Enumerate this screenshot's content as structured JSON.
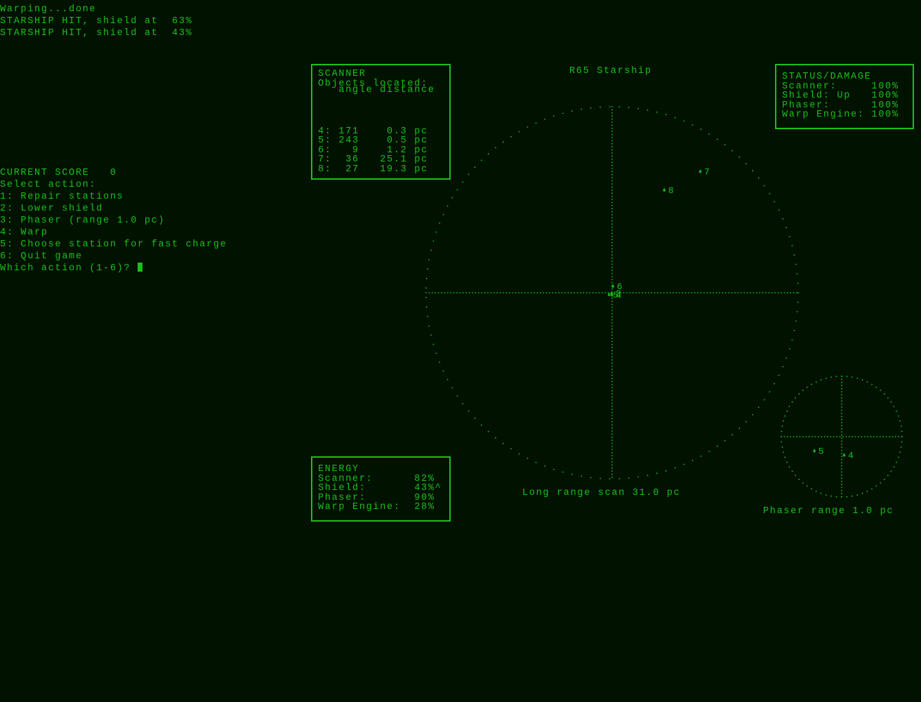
{
  "log": [
    "Warping...done",
    "STARSHIP HIT, shield at  63%",
    "STARSHIP HIT, shield at  43%"
  ],
  "menu": {
    "score_label": "CURRENT SCORE   0",
    "prompt_title": "Select action:",
    "options": [
      "1: Repair stations",
      "2: Lower shield",
      "3: Phaser (range 1.0 pc)",
      "4: Warp",
      "5: Choose station for fast charge",
      "6: Quit game"
    ],
    "input_prompt": "Which action (1-6)? "
  },
  "scanner": {
    "title": "SCANNER",
    "subtitle": "Objects located:",
    "header": "   angle distance",
    "rows": [
      "4: 171    0.3 pc",
      "5: 243    0.5 pc",
      "6:   9    1.2 pc",
      "7:  36   25.1 pc",
      "8:  27   19.3 pc"
    ]
  },
  "energy": {
    "title": "ENERGY",
    "rows": [
      "Scanner:      82%",
      "Shield:       43%^",
      "Phaser:       90%",
      "Warp Engine:  28%"
    ]
  },
  "status": {
    "title": "STATUS/DAMAGE",
    "rows": [
      "Scanner:     100%",
      "Shield: Up   100%",
      "Phaser:      100%",
      "Warp Engine: 100%"
    ]
  },
  "long_range": {
    "title": "R65 Starship",
    "caption": "Long range scan 31.0 pc",
    "range_pc": 31.0,
    "objects": [
      {
        "id": "3",
        "label": "3",
        "angle": 0,
        "distance": 0.0
      },
      {
        "id": "4",
        "label": "4",
        "angle": 171,
        "distance": 0.3
      },
      {
        "id": "5",
        "label": "5",
        "angle": 243,
        "distance": 0.5
      },
      {
        "id": "6",
        "label": "6",
        "angle": 9,
        "distance": 1.2
      },
      {
        "id": "7",
        "label": "7",
        "angle": 36,
        "distance": 25.1
      },
      {
        "id": "8",
        "label": "8",
        "angle": 27,
        "distance": 19.3
      }
    ]
  },
  "phaser_scan": {
    "caption": "Phaser range 1.0 pc",
    "range_pc": 1.0,
    "objects": [
      {
        "id": "4",
        "label": "4",
        "angle": 171,
        "distance": 0.3
      },
      {
        "id": "5",
        "label": "5",
        "angle": 243,
        "distance": 0.5
      }
    ]
  },
  "colors": {
    "background": "#011200",
    "foreground": "#19c019"
  }
}
